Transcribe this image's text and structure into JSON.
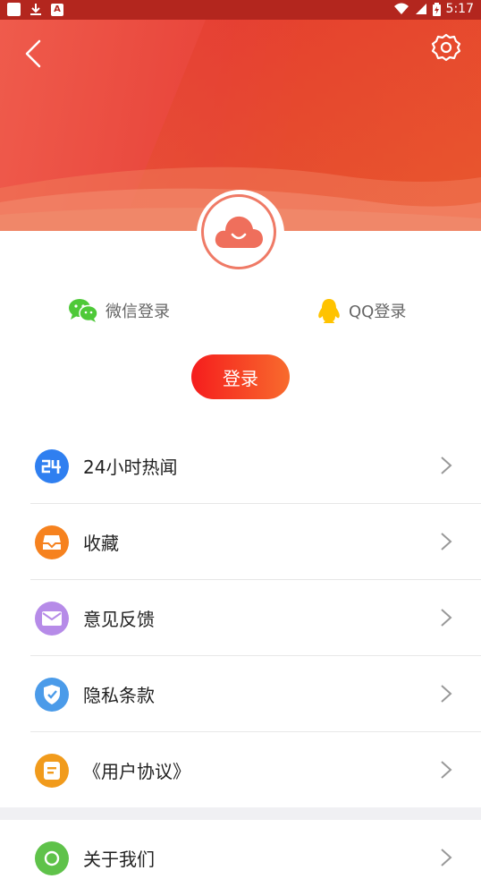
{
  "status_bar": {
    "time": "5:17",
    "notif_letter": "A"
  },
  "header": {
    "back_icon": "back-chevron-icon",
    "settings_icon": "gear-icon"
  },
  "avatar": {
    "icon": "smiling-cloud-icon",
    "color": "#ef7a66"
  },
  "social_login": {
    "wechat": {
      "label": "微信登录",
      "icon": "wechat-icon",
      "color": "#4ec938"
    },
    "qq": {
      "label": "QQ登录",
      "icon": "qq-penguin-icon",
      "color": "#ffc300"
    }
  },
  "login_button": {
    "label": "登录"
  },
  "menu": {
    "items": [
      {
        "label": "24小时热闻",
        "icon": "24-hours-icon",
        "color": "#2f7ff0",
        "glyph": "24"
      },
      {
        "label": "收藏",
        "icon": "favorites-box-icon",
        "color": "#f6821f"
      },
      {
        "label": "意见反馈",
        "icon": "envelope-icon",
        "color": "#b68be8"
      },
      {
        "label": "隐私条款",
        "icon": "shield-check-icon",
        "color": "#4b9be9"
      },
      {
        "label": "《用户协议》",
        "icon": "document-icon",
        "color": "#f19b1c"
      }
    ],
    "partial_item": {
      "label": "关于我们",
      "icon": "about-icon",
      "color": "#5fc24a"
    }
  },
  "colors": {
    "accent_red": "#f51d1d",
    "accent_orange": "#f86b2d",
    "header_red": "#e8443a"
  }
}
